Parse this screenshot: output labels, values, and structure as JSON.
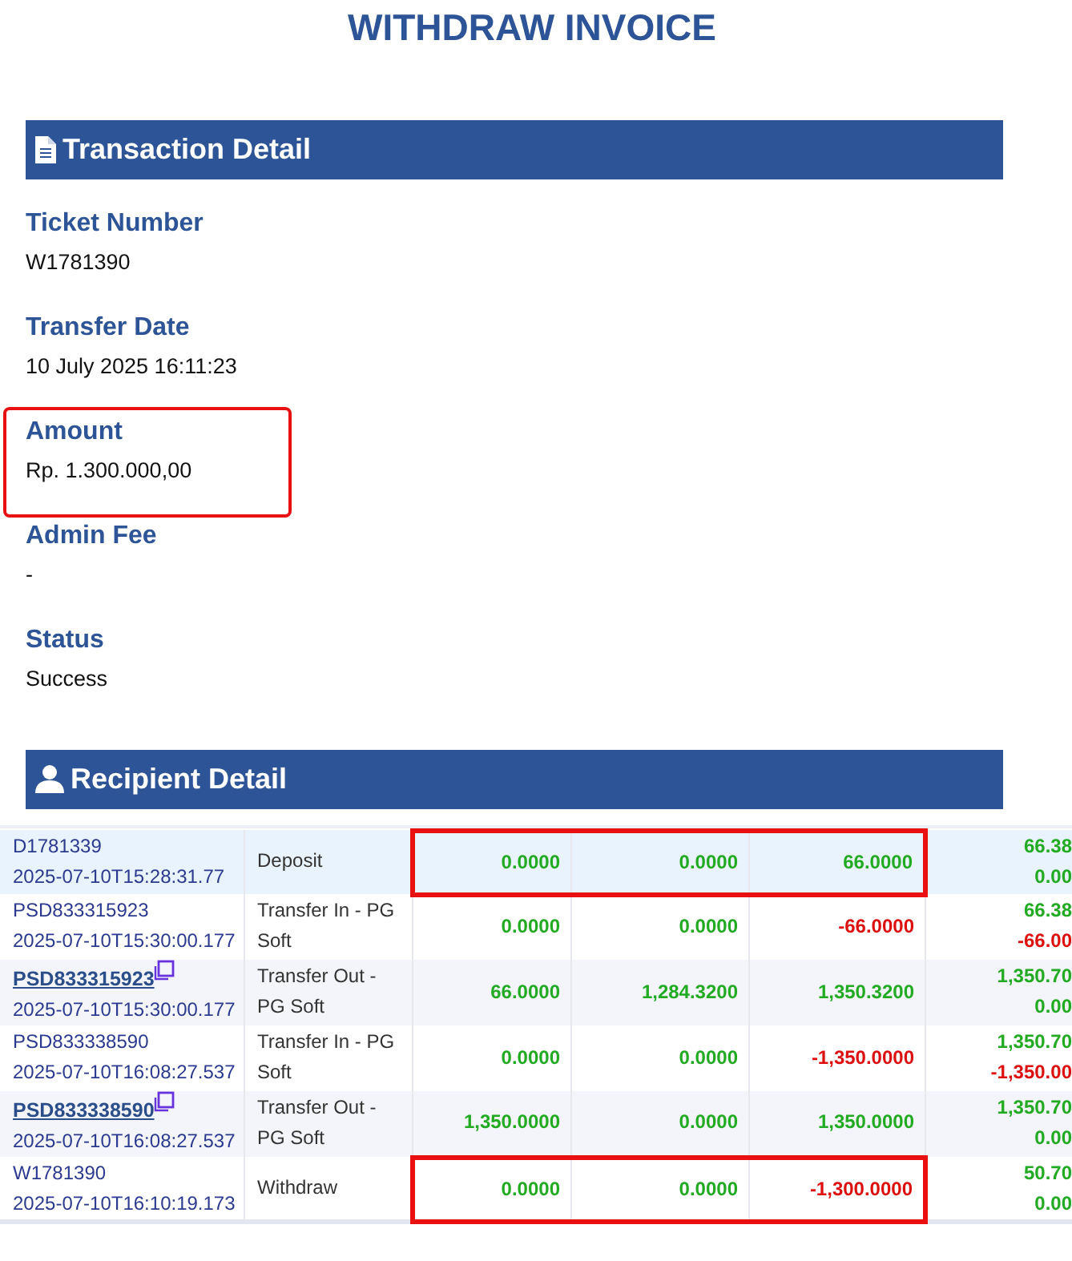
{
  "title": "WITHDRAW INVOICE",
  "transaction_section": {
    "heading": "Transaction Detail",
    "fields": [
      {
        "label": "Ticket Number",
        "value": "W1781390",
        "highlighted": false
      },
      {
        "label": "Transfer Date",
        "value": "10 July 2025 16:11:23",
        "highlighted": false
      },
      {
        "label": "Amount",
        "value": "Rp. 1.300.000,00",
        "highlighted": true
      },
      {
        "label": "Admin Fee",
        "value": "-",
        "highlighted": false
      },
      {
        "label": "Status",
        "value": "Success",
        "highlighted": false
      }
    ]
  },
  "recipient_section": {
    "heading": "Recipient Detail"
  },
  "table": {
    "rows": [
      {
        "selected": true,
        "highlighted": true,
        "id": "D1781339",
        "link": false,
        "time": "2025-07-10T15:28:31.77",
        "type": "Deposit",
        "values": [
          {
            "text": "0.0000",
            "negative": false
          },
          {
            "text": "0.0000",
            "negative": false
          },
          {
            "text": "66.0000",
            "negative": false
          }
        ],
        "balance": [
          {
            "text": "66.38",
            "negative": false
          },
          {
            "text": "0.00",
            "negative": false
          }
        ]
      },
      {
        "selected": false,
        "highlighted": false,
        "id": "PSD833315923",
        "link": false,
        "time": "2025-07-10T15:30:00.177",
        "type": "Transfer In - PG Soft",
        "values": [
          {
            "text": "0.0000",
            "negative": false
          },
          {
            "text": "0.0000",
            "negative": false
          },
          {
            "text": "-66.0000",
            "negative": true
          }
        ],
        "balance": [
          {
            "text": "66.38",
            "negative": false
          },
          {
            "text": "-66.00",
            "negative": true
          }
        ]
      },
      {
        "selected": false,
        "highlighted": false,
        "id": "PSD833315923",
        "link": true,
        "time": "2025-07-10T15:30:00.177",
        "type": "Transfer Out - PG Soft",
        "values": [
          {
            "text": "66.0000",
            "negative": false
          },
          {
            "text": "1,284.3200",
            "negative": false
          },
          {
            "text": "1,350.3200",
            "negative": false
          }
        ],
        "balance": [
          {
            "text": "1,350.70",
            "negative": false
          },
          {
            "text": "0.00",
            "negative": false
          }
        ]
      },
      {
        "selected": false,
        "highlighted": false,
        "id": "PSD833338590",
        "link": false,
        "time": "2025-07-10T16:08:27.537",
        "type": "Transfer In - PG Soft",
        "values": [
          {
            "text": "0.0000",
            "negative": false
          },
          {
            "text": "0.0000",
            "negative": false
          },
          {
            "text": "-1,350.0000",
            "negative": true
          }
        ],
        "balance": [
          {
            "text": "1,350.70",
            "negative": false
          },
          {
            "text": "-1,350.00",
            "negative": true
          }
        ]
      },
      {
        "selected": false,
        "highlighted": false,
        "id": "PSD833338590",
        "link": true,
        "time": "2025-07-10T16:08:27.537",
        "type": "Transfer Out - PG Soft",
        "values": [
          {
            "text": "1,350.0000",
            "negative": false
          },
          {
            "text": "0.0000",
            "negative": false
          },
          {
            "text": "1,350.0000",
            "negative": false
          }
        ],
        "balance": [
          {
            "text": "1,350.70",
            "negative": false
          },
          {
            "text": "0.00",
            "negative": false
          }
        ]
      },
      {
        "selected": false,
        "highlighted": true,
        "id": "W1781390",
        "link": false,
        "time": "2025-07-10T16:10:19.173",
        "type": "Withdraw",
        "values": [
          {
            "text": "0.0000",
            "negative": false
          },
          {
            "text": "0.0000",
            "negative": false
          },
          {
            "text": "-1,300.0000",
            "negative": true
          }
        ],
        "balance": [
          {
            "text": "50.70",
            "negative": false
          },
          {
            "text": "0.00",
            "negative": false
          }
        ]
      }
    ]
  }
}
